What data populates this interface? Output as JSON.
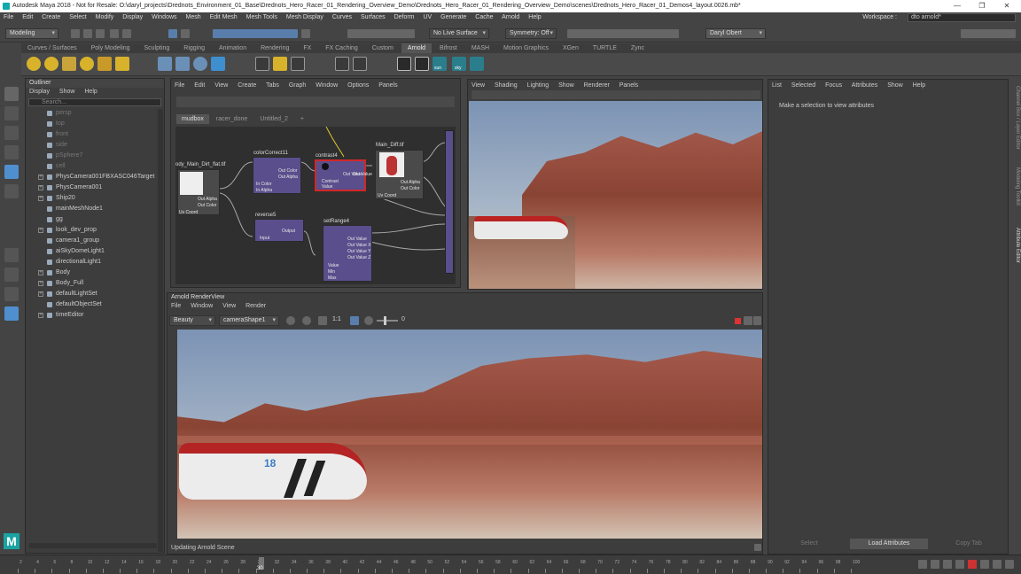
{
  "window": {
    "title": "Autodesk Maya 2018 - Not for Resale: O:\\daryl_projects\\Drednots_Environment_01_Base\\Drednots_Hero_Racer_01_Rendering_Overview_Demo\\Drednots_Hero_Racer_01_Rendering_Overview_Demo\\scenes\\Drednots_Hero_Racer_01_Demos4_layout.0026.mb*",
    "minimize": "—",
    "restore": "❐",
    "close": "✕"
  },
  "menubar": [
    "File",
    "Edit",
    "Create",
    "Select",
    "Modify",
    "Display",
    "Windows",
    "Mesh",
    "Edit Mesh",
    "Mesh Tools",
    "Mesh Display",
    "Curves",
    "Surfaces",
    "Deform",
    "UV",
    "Generate",
    "Cache",
    "Arnold",
    "Help"
  ],
  "workspace": {
    "label": "Workspace :",
    "value": "dto arnold*"
  },
  "statusline": {
    "menuset": "Modeling",
    "live_surface": "No Live Surface",
    "symmetry": "Symmetry: Off",
    "user": "Daryl Obert"
  },
  "shelf_tabs": [
    "Curves / Surfaces",
    "Poly Modeling",
    "Sculpting",
    "Rigging",
    "Animation",
    "Rendering",
    "FX",
    "FX Caching",
    "Custom",
    "Arnold",
    "Bifrost",
    "MASH",
    "Motion Graphics",
    "XGen",
    "TURTLE",
    "Zync"
  ],
  "shelf_active": "Arnold",
  "shelf_labels": {
    "sun": "sun",
    "sky": "sky"
  },
  "outliner": {
    "title": "Outliner",
    "menu": [
      "Display",
      "Show",
      "Help"
    ],
    "search_placeholder": "Search...",
    "items": [
      {
        "label": "persp",
        "dim": true,
        "exp": false
      },
      {
        "label": "top",
        "dim": true,
        "exp": false
      },
      {
        "label": "front",
        "dim": true,
        "exp": false
      },
      {
        "label": "side",
        "dim": true,
        "exp": false
      },
      {
        "label": "pSphere7",
        "dim": true,
        "exp": false
      },
      {
        "label": "cell",
        "dim": true,
        "exp": false
      },
      {
        "label": "PhysCamera001FBXASC046Target",
        "dim": false,
        "exp": true
      },
      {
        "label": "PhysCamera001",
        "dim": false,
        "exp": true
      },
      {
        "label": "Ship20",
        "dim": false,
        "exp": true
      },
      {
        "label": "mainMeshNode1",
        "dim": false,
        "exp": false
      },
      {
        "label": "gg",
        "dim": false,
        "exp": false
      },
      {
        "label": "look_dev_prop",
        "dim": false,
        "exp": true
      },
      {
        "label": "camera1_group",
        "dim": false,
        "exp": false
      },
      {
        "label": "aiSkyDomeLight1",
        "dim": false,
        "exp": false
      },
      {
        "label": "directionalLight1",
        "dim": false,
        "exp": false
      },
      {
        "label": "Body",
        "dim": false,
        "exp": true
      },
      {
        "label": "Body_Full",
        "dim": false,
        "exp": true
      },
      {
        "label": "defaultLightSet",
        "dim": false,
        "exp": true
      },
      {
        "label": "defaultObjectSet",
        "dim": false,
        "exp": false
      },
      {
        "label": "timeEditor",
        "dim": false,
        "exp": true
      }
    ]
  },
  "hypershade": {
    "menu": [
      "File",
      "Edit",
      "View",
      "Create",
      "Tabs",
      "Graph",
      "Window",
      "Options",
      "Panels"
    ],
    "tabs": [
      "mudbox",
      "racer_done",
      "Untitled_2",
      "+"
    ],
    "nodes": {
      "file1": {
        "title": "ody_Main_Dirt_flat.tif",
        "ports": [
          "Out Alpha",
          "Out Color",
          "Uv Coord"
        ]
      },
      "cc": {
        "title": "colorCorrect11",
        "ports": [
          "Out Color",
          "Out Alpha",
          "In Color",
          "In Alpha"
        ]
      },
      "contrast": {
        "title": "contrast4",
        "ports": [
          "Out Value",
          "Contrast",
          "Value"
        ]
      },
      "diff": {
        "title": "Main_Diff.tif",
        "ports": [
          "Out Value",
          "Out Alpha",
          "Out Color",
          "Uv Coord"
        ]
      },
      "reverse": {
        "title": "reverse5",
        "ports": [
          "Output",
          "Input"
        ]
      },
      "setrange": {
        "title": "setRange4",
        "ports": [
          "Out Value",
          "Out Value X",
          "Out Value Y",
          "Out Value Z",
          "Value",
          "Min",
          "Max"
        ]
      }
    }
  },
  "viewport": {
    "menu": [
      "View",
      "Shading",
      "Lighting",
      "Show",
      "Renderer",
      "Panels"
    ]
  },
  "renderview": {
    "title": "Arnold RenderView",
    "menu": [
      "File",
      "Window",
      "View",
      "Render"
    ],
    "aov": "Beauty",
    "camera": "cameraShape1",
    "ratio": "1:1",
    "exposure": "0",
    "status": "Updating Arnold Scene",
    "decal_number": "18"
  },
  "attribute_editor": {
    "menu": [
      "List",
      "Selected",
      "Focus",
      "Attributes",
      "Show",
      "Help"
    ],
    "message": "Make a selection to view attributes",
    "buttons": [
      "Select",
      "Load Attributes",
      "Copy Tab"
    ]
  },
  "side_tabs": [
    "Channel Box / Layer Editor",
    "Modeling Toolkit",
    "Attribute Editor"
  ],
  "timeline": {
    "ticks": [
      "2",
      "4",
      "6",
      "8",
      "10",
      "12",
      "14",
      "16",
      "18",
      "20",
      "22",
      "24",
      "26",
      "28",
      "30",
      "32",
      "34",
      "36",
      "38",
      "40",
      "42",
      "44",
      "46",
      "48",
      "50",
      "52",
      "54",
      "56",
      "58",
      "60",
      "62",
      "64",
      "66",
      "68",
      "70",
      "72",
      "74",
      "76",
      "78",
      "80",
      "82",
      "84",
      "86",
      "88",
      "90",
      "92",
      "94",
      "96",
      "98",
      "100"
    ],
    "current_frame": "30"
  },
  "colors": {
    "accent": "#5a7eab",
    "node": "#5a4e8c",
    "selected_node_border": "#d02828",
    "maya_logo": "#1aa3a3"
  }
}
